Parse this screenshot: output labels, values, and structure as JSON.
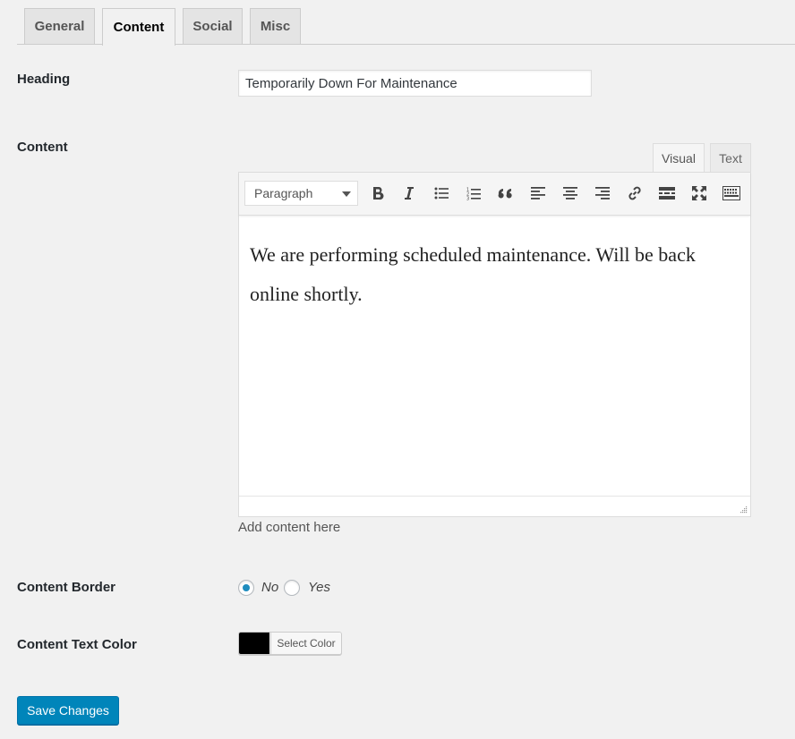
{
  "tabs": [
    {
      "label": "General",
      "active": false
    },
    {
      "label": "Content",
      "active": true
    },
    {
      "label": "Social",
      "active": false
    },
    {
      "label": "Misc",
      "active": false
    }
  ],
  "heading": {
    "label": "Heading",
    "value": "Temporarily Down For Maintenance"
  },
  "content": {
    "label": "Content",
    "mode_tabs": {
      "visual": "Visual",
      "text": "Text",
      "active": "Visual"
    },
    "format_select": "Paragraph",
    "toolbar_icons": [
      "bold-icon",
      "italic-icon",
      "bulleted-list-icon",
      "numbered-list-icon",
      "blockquote-icon",
      "align-left-icon",
      "align-center-icon",
      "align-right-icon",
      "link-icon",
      "read-more-icon",
      "fullscreen-icon",
      "toolbar-toggle-icon"
    ],
    "body_text": "We are performing scheduled maintenance. Will be back online shortly.",
    "hint": "Add content here"
  },
  "content_border": {
    "label": "Content Border",
    "options": [
      "No",
      "Yes"
    ],
    "selected": "No"
  },
  "content_text_color": {
    "label": "Content Text Color",
    "button_label": "Select Color",
    "value": "#000000"
  },
  "save_label": "Save Changes",
  "colors": {
    "accent": "#0085ba",
    "radio": "#1e8cbe",
    "background": "#f1f1f1"
  }
}
